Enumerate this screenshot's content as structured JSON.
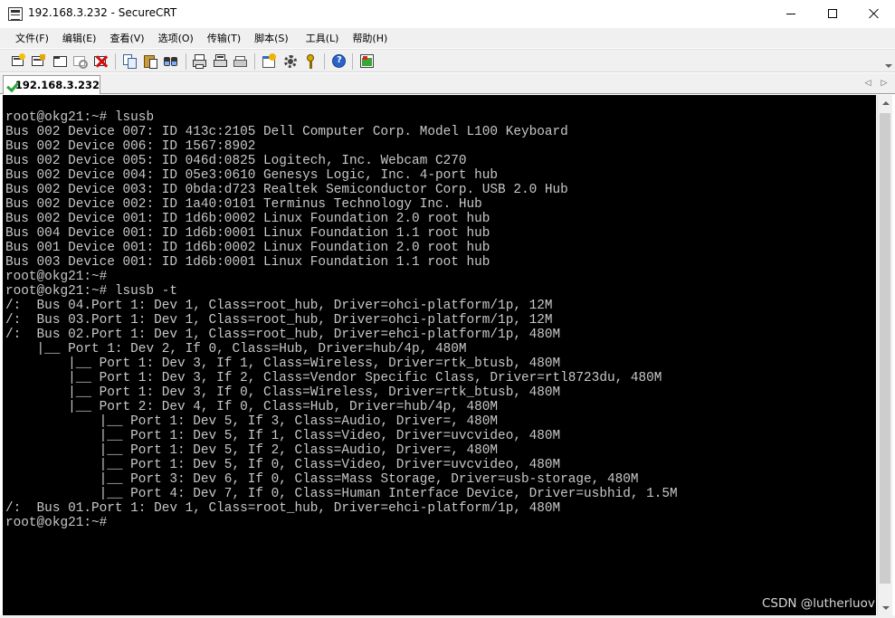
{
  "window": {
    "title": "192.168.3.232 - SecureCRT"
  },
  "menu": {
    "items": [
      "文件(F)",
      "编辑(E)",
      "查看(V)",
      "选项(O)",
      "传输(T)",
      "脚本(S)",
      "工具(L)",
      "帮助(H)"
    ]
  },
  "toolbar": {
    "icons": [
      "connect-icon",
      "quick-connect-icon",
      "connect-tab-icon",
      "reconnect-icon",
      "disconnect-icon",
      "copy-icon",
      "paste-icon",
      "find-icon",
      "print-icon",
      "print-selection-icon",
      "print-setup-icon",
      "session-options-icon",
      "global-options-icon",
      "keymap-icon",
      "help-icon",
      "about-icon"
    ]
  },
  "tabs": [
    {
      "label": "192.168.3.232",
      "status": "connected",
      "icon": "check-icon"
    }
  ],
  "terminal": {
    "background": "#000000",
    "foreground": "#c8c8c8",
    "lines": [
      "root@okg21:~# lsusb",
      "Bus 002 Device 007: ID 413c:2105 Dell Computer Corp. Model L100 Keyboard",
      "Bus 002 Device 006: ID 1567:8902",
      "Bus 002 Device 005: ID 046d:0825 Logitech, Inc. Webcam C270",
      "Bus 002 Device 004: ID 05e3:0610 Genesys Logic, Inc. 4-port hub",
      "Bus 002 Device 003: ID 0bda:d723 Realtek Semiconductor Corp. USB 2.0 Hub",
      "Bus 002 Device 002: ID 1a40:0101 Terminus Technology Inc. Hub",
      "Bus 002 Device 001: ID 1d6b:0002 Linux Foundation 2.0 root hub",
      "Bus 004 Device 001: ID 1d6b:0001 Linux Foundation 1.1 root hub",
      "Bus 001 Device 001: ID 1d6b:0002 Linux Foundation 2.0 root hub",
      "Bus 003 Device 001: ID 1d6b:0001 Linux Foundation 1.1 root hub",
      "root@okg21:~#",
      "root@okg21:~# lsusb -t",
      "/:  Bus 04.Port 1: Dev 1, Class=root_hub, Driver=ohci-platform/1p, 12M",
      "/:  Bus 03.Port 1: Dev 1, Class=root_hub, Driver=ohci-platform/1p, 12M",
      "/:  Bus 02.Port 1: Dev 1, Class=root_hub, Driver=ehci-platform/1p, 480M",
      "    |__ Port 1: Dev 2, If 0, Class=Hub, Driver=hub/4p, 480M",
      "        |__ Port 1: Dev 3, If 1, Class=Wireless, Driver=rtk_btusb, 480M",
      "        |__ Port 1: Dev 3, If 2, Class=Vendor Specific Class, Driver=rtl8723du, 480M",
      "        |__ Port 1: Dev 3, If 0, Class=Wireless, Driver=rtk_btusb, 480M",
      "        |__ Port 2: Dev 4, If 0, Class=Hub, Driver=hub/4p, 480M",
      "            |__ Port 1: Dev 5, If 3, Class=Audio, Driver=, 480M",
      "            |__ Port 1: Dev 5, If 1, Class=Video, Driver=uvcvideo, 480M",
      "            |__ Port 1: Dev 5, If 2, Class=Audio, Driver=, 480M",
      "            |__ Port 1: Dev 5, If 0, Class=Video, Driver=uvcvideo, 480M",
      "            |__ Port 3: Dev 6, If 0, Class=Mass Storage, Driver=usb-storage, 480M",
      "            |__ Port 4: Dev 7, If 0, Class=Human Interface Device, Driver=usbhid, 1.5M",
      "/:  Bus 01.Port 1: Dev 1, Class=root_hub, Driver=ehci-platform/1p, 480M",
      "root@okg21:~#"
    ]
  },
  "watermark": "CSDN @lutherluov"
}
